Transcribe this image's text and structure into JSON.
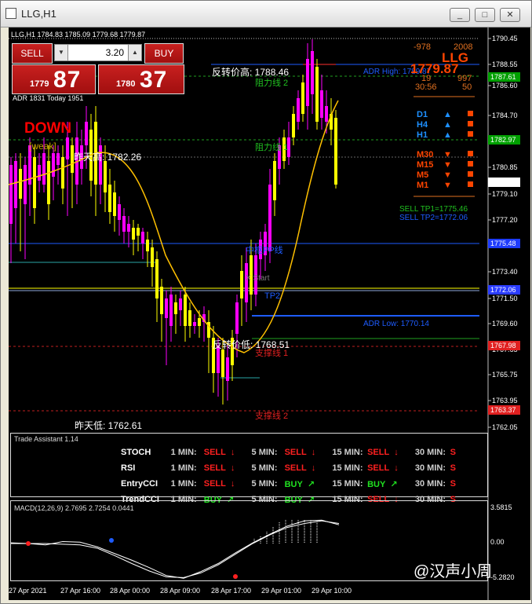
{
  "window": {
    "title": "LLG,H1",
    "min_btn": "_",
    "max_btn": "□",
    "close_btn": "✕"
  },
  "chart": {
    "header": "LLG,H1  1784.83 1785.09 1779.68 1779.87",
    "price_axis": [
      "1790.45",
      "1788.55",
      "1786.60",
      "1784.70",
      "1782.75",
      "1780.85",
      "1779.87",
      "1779.10",
      "1777.20",
      "1775.25",
      "1773.40",
      "1772.06",
      "1771.50",
      "1769.60",
      "1767.65",
      "1765.75",
      "1763.95",
      "1762.05"
    ],
    "axis_tags": {
      "t1": "1787.61",
      "t2": "1782.97",
      "t3": "1775.48",
      "t4": "1772.06",
      "t5": "1767.98",
      "t6": "1763.37"
    },
    "time_axis": [
      "27 Apr 2021",
      "27 Apr 16:00",
      "28 Apr 00:00",
      "28 Apr 09:00",
      "28 Apr 17:00",
      "29 Apr 01:00",
      "29 Apr 10:00"
    ],
    "labels": {
      "rev_high": "反转价高: 1788.46",
      "rev_low": "反转价低: 1768.51",
      "yday_high": "昨天高: 1782.26",
      "yday_low": "昨天低: 1762.61",
      "res2": "阻力线 2",
      "res1": "阻力线 1",
      "sup1": "支撑线 1",
      "sup2": "支撑线 2",
      "adr_high": "ADR High: 1789.87",
      "adr_low": "ADR Low: 1770.14",
      "pivot": "中枢PP线",
      "xstart": "X Start",
      "tp2": "TP2",
      "adr_info": "ADR 1831   Today 1951",
      "down": "DOWN",
      "weak": "[weak]"
    },
    "info": {
      "v1": "-978",
      "v2": "2008",
      "symbol": "LLG",
      "price": "1779.87",
      "n1": "19",
      "n2": "997",
      "timer": "30:56",
      "n3": "50",
      "sell_tp1": "SELL TP1=1775.46",
      "sell_tp2": "SELL TP2=1772.06"
    },
    "timeframes": [
      {
        "tf": "D1",
        "dir": "▲"
      },
      {
        "tf": "H4",
        "dir": "▲"
      },
      {
        "tf": "H1",
        "dir": "▲"
      },
      {
        "tf": "M30",
        "dir": "▼"
      },
      {
        "tf": "M15",
        "dir": "▼"
      },
      {
        "tf": "M5",
        "dir": "▼"
      },
      {
        "tf": "M1",
        "dir": "▼"
      }
    ],
    "colors": {
      "bull": "#ff00ff",
      "bear": "#ffff00",
      "ma": "#ffc000",
      "accent": "#ff4500",
      "up": "#1e90ff",
      "down": "#ff4500"
    }
  },
  "trade_panel": {
    "sell": "SELL",
    "buy": "BUY",
    "lot": "3.20",
    "sell_small": "1779",
    "sell_big": "87",
    "buy_small": "1780",
    "buy_big": "37"
  },
  "assistant": {
    "title": "Trade Assistant 1.14",
    "rows": [
      {
        "name": "STOCH",
        "c": [
          [
            "1 MIN:",
            "SELL",
            "↓"
          ],
          [
            "5 MIN:",
            "SELL",
            "↓"
          ],
          [
            "15 MIN:",
            "SELL",
            "↓"
          ],
          [
            "30 MIN:",
            "S",
            ""
          ]
        ]
      },
      {
        "name": "RSI",
        "c": [
          [
            "1 MIN:",
            "SELL",
            "↓"
          ],
          [
            "5 MIN:",
            "SELL",
            "↓"
          ],
          [
            "15 MIN:",
            "SELL",
            "↓"
          ],
          [
            "30 MIN:",
            "S",
            ""
          ]
        ]
      },
      {
        "name": "EntryCCI",
        "c": [
          [
            "1 MIN:",
            "SELL",
            "↓"
          ],
          [
            "5 MIN:",
            "BUY",
            "↗"
          ],
          [
            "15 MIN:",
            "BUY",
            "↗"
          ],
          [
            "30 MIN:",
            "S",
            ""
          ]
        ]
      },
      {
        "name": "TrendCCI",
        "c": [
          [
            "1 MIN:",
            "BUY",
            "↗"
          ],
          [
            "5 MIN:",
            "BUY",
            "↗"
          ],
          [
            "15 MIN:",
            "SELL",
            "↓"
          ],
          [
            "30 MIN:",
            "S",
            ""
          ]
        ]
      }
    ]
  },
  "macd": {
    "title": "MACD(12,26,9) 2.7695 2.7254 0.0441",
    "axis": [
      "3.5815",
      "0.00",
      "-5.2820"
    ],
    "hist": [
      0.2,
      0.3,
      0.5,
      0.7,
      0.9,
      1.0,
      1.0,
      1.0,
      1.0,
      1.0,
      1.0
    ],
    "main": [
      0.1,
      0.0,
      -0.2,
      0.3,
      0.2,
      -0.5,
      -1.5,
      -2.5,
      -3.6,
      -4.8,
      -5.2,
      -4.2,
      -3.0,
      -1.4,
      0.1,
      1.4,
      2.6,
      3.4,
      3.5,
      2.8
    ],
    "signal": [
      0.0,
      0.0,
      0.0,
      -0.1,
      -0.2,
      -0.7,
      -1.8,
      -3.0,
      -4.1,
      -5.0,
      -5.1,
      -4.4,
      -3.2,
      -1.6,
      0.0,
      1.3,
      2.4,
      3.0,
      3.4,
      3.0
    ]
  },
  "watermark": "@汉声小周"
}
